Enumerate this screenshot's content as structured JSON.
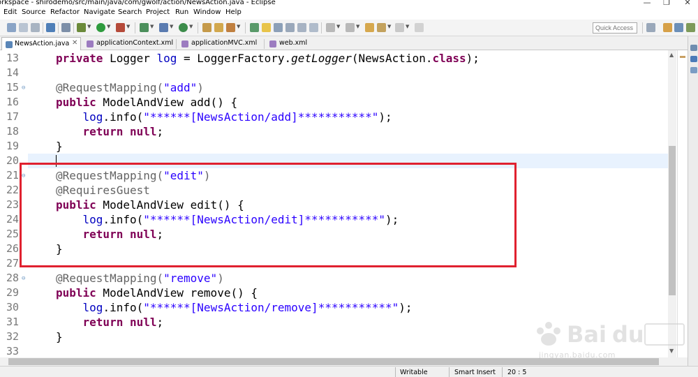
{
  "window": {
    "title": "orkspace - shirodemo/src/main/java/com/gwolf/action/NewsAction.java - Eclipse"
  },
  "menu": {
    "items": [
      "Edit",
      "Source",
      "Refactor",
      "Navigate",
      "Search",
      "Project",
      "Run",
      "Window",
      "Help"
    ]
  },
  "toolbar": {
    "quick_access_placeholder": "Quick Access"
  },
  "tabs": [
    {
      "label": "NewsAction.java",
      "active": true,
      "close": "✕"
    },
    {
      "label": "applicationContext.xml",
      "active": false
    },
    {
      "label": "applicationMVC.xml",
      "active": false
    },
    {
      "label": "web.xml",
      "active": false
    }
  ],
  "editor": {
    "lines": [
      {
        "num": "13",
        "fold": "",
        "parts": [
          [
            "kw",
            "private"
          ],
          [
            "",
            " Logger "
          ],
          [
            "fld",
            "log"
          ],
          [
            "",
            " = LoggerFactory."
          ],
          [
            "it",
            "getLogger"
          ],
          [
            "",
            "(NewsAction."
          ],
          [
            "kw",
            "class"
          ],
          [
            "",
            ");"
          ]
        ]
      },
      {
        "num": "14",
        "fold": "",
        "parts": []
      },
      {
        "num": "15",
        "fold": "⊖",
        "parts": [
          [
            "an",
            "@RequestMapping("
          ],
          [
            "st",
            "\"add\""
          ],
          [
            "an",
            ")"
          ]
        ]
      },
      {
        "num": "16",
        "fold": "",
        "parts": [
          [
            "kw",
            "public"
          ],
          [
            "",
            " ModelAndView add() {"
          ]
        ]
      },
      {
        "num": "17",
        "fold": "",
        "parts": [
          [
            "",
            "    "
          ],
          [
            "fld",
            "log"
          ],
          [
            "",
            ".info("
          ],
          [
            "st",
            "\"******[NewsAction/add]***********\""
          ],
          [
            "",
            ");"
          ]
        ]
      },
      {
        "num": "18",
        "fold": "",
        "parts": [
          [
            "",
            "    "
          ],
          [
            "kw",
            "return"
          ],
          [
            "",
            " "
          ],
          [
            "kw",
            "null"
          ],
          [
            "",
            ";"
          ]
        ]
      },
      {
        "num": "19",
        "fold": "",
        "parts": [
          [
            "",
            "}"
          ]
        ]
      },
      {
        "num": "20",
        "fold": "",
        "parts": []
      },
      {
        "num": "21",
        "fold": "⊖",
        "parts": [
          [
            "an",
            "@RequestMapping("
          ],
          [
            "st",
            "\"edit\""
          ],
          [
            "an",
            ")"
          ]
        ]
      },
      {
        "num": "22",
        "fold": "",
        "parts": [
          [
            "an",
            "@RequiresGuest"
          ]
        ]
      },
      {
        "num": "23",
        "fold": "",
        "parts": [
          [
            "kw",
            "public"
          ],
          [
            "",
            " ModelAndView edit() {"
          ]
        ]
      },
      {
        "num": "24",
        "fold": "",
        "parts": [
          [
            "",
            "    "
          ],
          [
            "fld",
            "log"
          ],
          [
            "",
            ".info("
          ],
          [
            "st",
            "\"******[NewsAction/edit]***********\""
          ],
          [
            "",
            ");"
          ]
        ]
      },
      {
        "num": "25",
        "fold": "",
        "parts": [
          [
            "",
            "    "
          ],
          [
            "kw",
            "return"
          ],
          [
            "",
            " "
          ],
          [
            "kw",
            "null"
          ],
          [
            "",
            ";"
          ]
        ]
      },
      {
        "num": "26",
        "fold": "",
        "parts": [
          [
            "",
            "}"
          ]
        ]
      },
      {
        "num": "27",
        "fold": "",
        "parts": []
      },
      {
        "num": "28",
        "fold": "⊖",
        "parts": [
          [
            "an",
            "@RequestMapping("
          ],
          [
            "st",
            "\"remove\""
          ],
          [
            "an",
            ")"
          ]
        ]
      },
      {
        "num": "29",
        "fold": "",
        "parts": [
          [
            "kw",
            "public"
          ],
          [
            "",
            " ModelAndView remove() {"
          ]
        ]
      },
      {
        "num": "30",
        "fold": "",
        "parts": [
          [
            "",
            "    "
          ],
          [
            "fld",
            "log"
          ],
          [
            "",
            ".info("
          ],
          [
            "st",
            "\"******[NewsAction/remove]***********\""
          ],
          [
            "",
            ");"
          ]
        ]
      },
      {
        "num": "31",
        "fold": "",
        "parts": [
          [
            "",
            "    "
          ],
          [
            "kw",
            "return"
          ],
          [
            "",
            " "
          ],
          [
            "kw",
            "null"
          ],
          [
            "",
            ";"
          ]
        ]
      },
      {
        "num": "32",
        "fold": "",
        "parts": [
          [
            "",
            "}"
          ]
        ]
      },
      {
        "num": "33",
        "fold": "",
        "parts": []
      }
    ],
    "current_line": "20"
  },
  "status": {
    "writable": "Writable",
    "insert_mode": "Smart Insert",
    "position": "20 : 5"
  },
  "watermark": {
    "text": "jingyan.baidu.com"
  },
  "colors": {
    "keyword": "#7f0055",
    "annotation": "#646464",
    "string": "#2a00ff",
    "field": "#0000c0",
    "highlight_box": "#e0212f",
    "current_line": "#e8f2fe"
  }
}
